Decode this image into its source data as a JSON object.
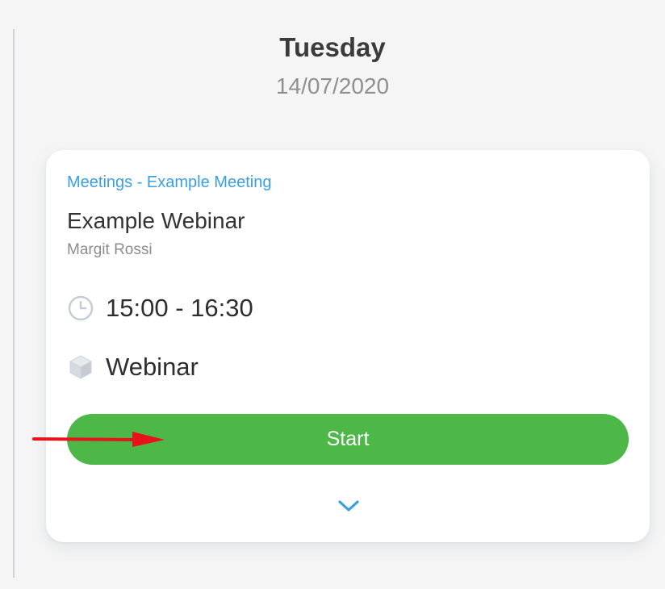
{
  "day": {
    "name": "Tuesday",
    "date": "14/07/2020"
  },
  "event": {
    "category": "Meetings - Example Meeting",
    "title": "Example Webinar",
    "host": "Margit Rossi",
    "time": "15:00 - 16:30",
    "type": "Webinar",
    "start_label": "Start"
  },
  "icons": {
    "time": "clock-icon",
    "type": "cube-icon",
    "expand": "chevron-down-icon",
    "annotation": "red-arrow-icon"
  },
  "colors": {
    "accent_blue": "#3a9fe0",
    "start_green": "#4db748",
    "annotation_red": "#e8131a"
  }
}
